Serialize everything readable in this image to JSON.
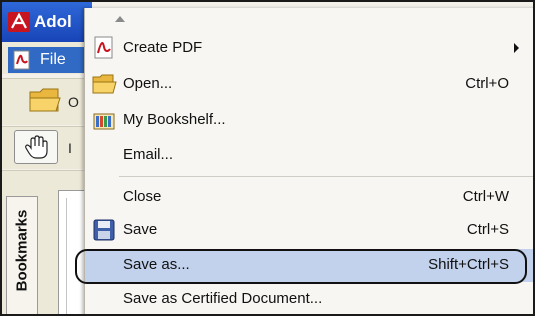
{
  "app": {
    "title_fragment": "Adol",
    "menubar": {
      "file_label": "File"
    },
    "toolbar_letter_1": "O",
    "toolbar_letter_2": "I",
    "nav": {
      "bookmarks_label": "Bookmarks"
    }
  },
  "file_menu": {
    "items": [
      {
        "label": "Create PDF",
        "shortcut": "",
        "icon": "create-pdf-icon",
        "submenu": true
      },
      {
        "label": "Open...",
        "shortcut": "Ctrl+O",
        "icon": "open-folder-icon"
      },
      {
        "label": "My Bookshelf...",
        "shortcut": "",
        "icon": "bookshelf-icon"
      },
      {
        "label": "Email...",
        "shortcut": "",
        "icon": ""
      },
      {
        "label": "Close",
        "shortcut": "Ctrl+W",
        "icon": ""
      },
      {
        "label": "Save",
        "shortcut": "Ctrl+S",
        "icon": "save-disk-icon"
      },
      {
        "label": "Save as...",
        "shortcut": "Shift+Ctrl+S",
        "icon": "",
        "highlighted": true
      },
      {
        "label": "Save as Certified Document...",
        "shortcut": "",
        "icon": ""
      }
    ]
  },
  "colors": {
    "titlebar": "#2455c8",
    "menu_selection": "#316ac5",
    "item_highlight": "#c2d1ec",
    "menu_background": "#f7f6f2",
    "callout_border": "#111111"
  }
}
